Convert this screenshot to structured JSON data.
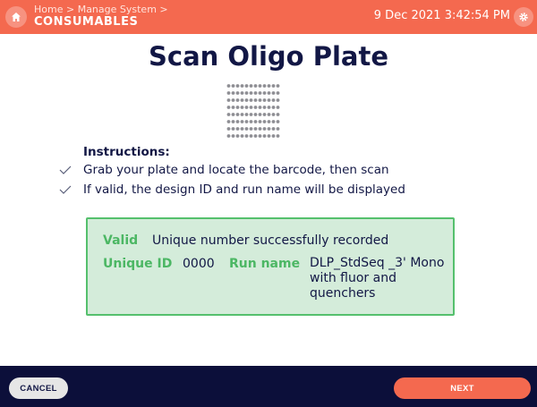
{
  "header": {
    "breadcrumb_home": "Home",
    "breadcrumb_sep": ">",
    "breadcrumb_manage": "Manage System",
    "section_title": "CONSUMABLES",
    "datetime": "9 Dec 2021 3:42:54 PM",
    "icons": {
      "home": "home-icon",
      "settings": "gear-icon"
    }
  },
  "main": {
    "title": "Scan Oligo Plate",
    "plate_icon": "well-plate-icon",
    "instructions": {
      "heading": "Instructions:",
      "steps": [
        "Grab your plate and locate the barcode, then scan",
        "If valid, the design ID and run name will be displayed"
      ]
    },
    "result": {
      "status_label": "Valid",
      "status_text": "Unique number successfully recorded",
      "unique_id_label": "Unique ID",
      "unique_id_value": "0000",
      "run_name_label": "Run name",
      "run_name_value": "DLP_StdSeq _3' Mono with fluor and quenchers"
    }
  },
  "footer": {
    "cancel_label": "CANCEL",
    "next_label": "NEXT"
  },
  "colors": {
    "header_bg": "#f4694f",
    "footer_bg": "#0c0f3a",
    "title": "#121745",
    "success_bg": "#d4ecda",
    "success_border": "#55c06d",
    "success_label": "#4cb764"
  }
}
